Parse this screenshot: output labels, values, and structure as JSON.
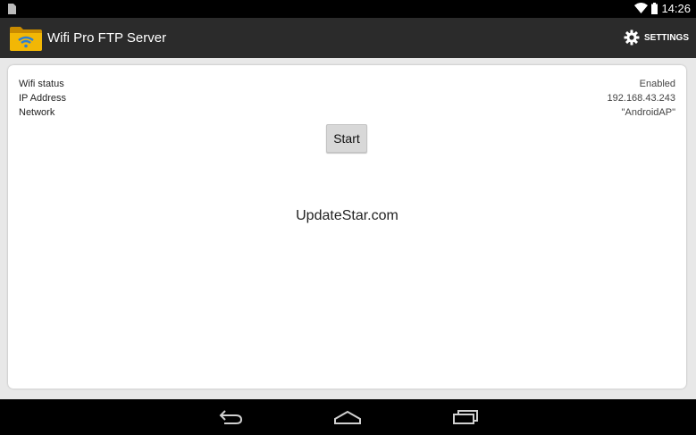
{
  "status_bar": {
    "time": "14:26",
    "icons": [
      "sim-icon",
      "wifi-icon",
      "battery-icon"
    ]
  },
  "action_bar": {
    "title": "Wifi Pro FTP Server",
    "settings_label": "SETTINGS",
    "icons": [
      "folder-wifi-app-icon",
      "gear-icon"
    ]
  },
  "info": {
    "rows": [
      {
        "label": "Wifi status",
        "value": "Enabled"
      },
      {
        "label": "IP Address",
        "value": "192.168.43.243"
      },
      {
        "label": "Network",
        "value": "\"AndroidAP\""
      }
    ]
  },
  "start_button_label": "Start",
  "watermark": "UpdateStar.com",
  "nav_bar": {
    "icons": [
      "back-icon",
      "home-icon",
      "recent-apps-icon"
    ]
  },
  "colors": {
    "action_bar": "#2b2b2b",
    "folder_yellow": "#f2b705",
    "content_bg": "#e8e8e8"
  }
}
